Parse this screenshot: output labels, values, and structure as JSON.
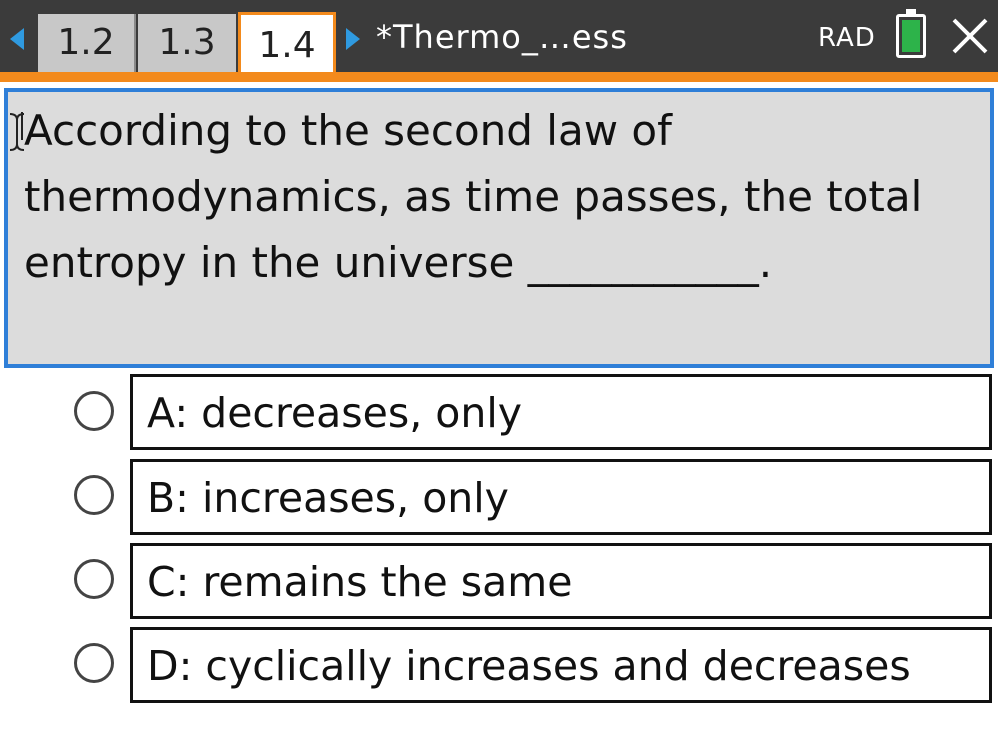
{
  "topbar": {
    "tabs": [
      {
        "label": "1.2"
      },
      {
        "label": "1.3"
      },
      {
        "label": "1.4"
      }
    ],
    "document_title": "*Thermo_…ess",
    "angle_mode": "RAD"
  },
  "question": {
    "text": "According to the second law of thermodynamics, as time passes, the total entropy in the universe ___________."
  },
  "choices": [
    {
      "label": "A:  decreases, only"
    },
    {
      "label": "B:  increases, only"
    },
    {
      "label": "C:  remains the same"
    },
    {
      "label": "D:  cyclically increases and decreases"
    }
  ],
  "colors": {
    "accent_orange": "#f38a1c",
    "selection_blue": "#2f7fd8",
    "battery_green": "#2db34a",
    "topbar_dark": "#3b3b3b"
  }
}
